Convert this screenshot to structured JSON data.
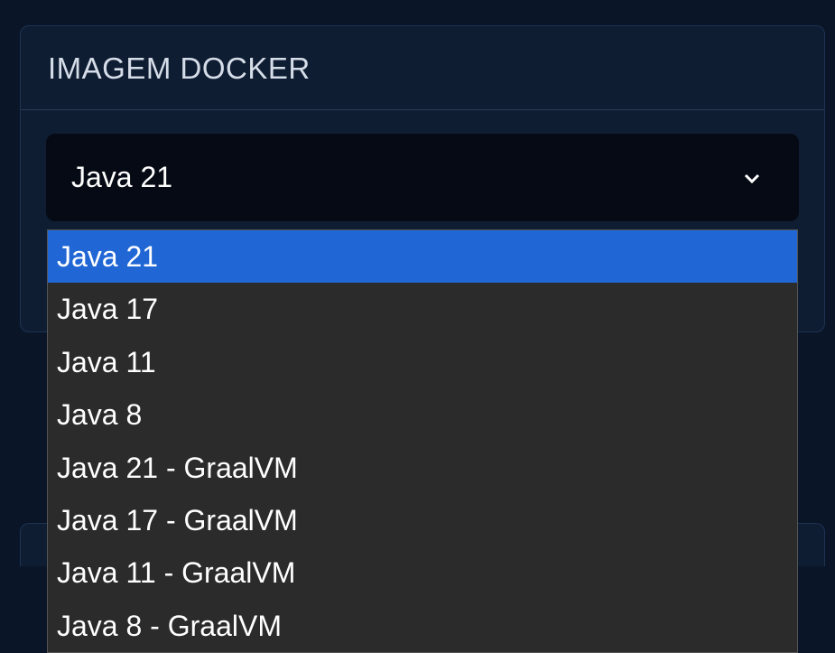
{
  "panel": {
    "title": "IMAGEM DOCKER"
  },
  "select": {
    "value": "Java 21",
    "options": [
      {
        "label": "Java 21",
        "selected": true
      },
      {
        "label": "Java 17",
        "selected": false
      },
      {
        "label": "Java 11",
        "selected": false
      },
      {
        "label": "Java 8",
        "selected": false
      },
      {
        "label": "Java 21 - GraalVM",
        "selected": false
      },
      {
        "label": "Java 17 - GraalVM",
        "selected": false
      },
      {
        "label": "Java 11 - GraalVM",
        "selected": false
      },
      {
        "label": "Java 8 - GraalVM",
        "selected": false
      }
    ]
  }
}
